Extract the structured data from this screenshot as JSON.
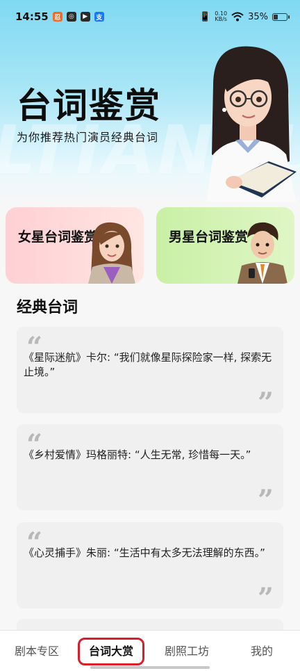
{
  "status_bar": {
    "time": "14:55",
    "app_icons": [
      {
        "name": "app-icon-orange",
        "color": "#f06a2a",
        "glyph": "忍"
      },
      {
        "name": "app-icon-dark-swirl",
        "color": "#2a2a2a",
        "glyph": "◎"
      },
      {
        "name": "app-icon-play",
        "color": "#2b2b2b",
        "glyph": "▶"
      },
      {
        "name": "app-icon-alipay",
        "color": "#1677ff",
        "glyph": "支"
      }
    ],
    "net_speed_value": "0.10",
    "net_speed_unit": "KB/s",
    "battery": "35%",
    "battery_level": 0.35
  },
  "banner": {
    "title": "台词鉴赏",
    "subtitle": "为你推荐热门演员经典台词",
    "watermark": "LTIANXUA"
  },
  "categories": [
    {
      "label": "女星台词鉴赏"
    },
    {
      "label": "男星台词鉴赏"
    }
  ],
  "section": {
    "title": "经典台词"
  },
  "quotes": [
    {
      "text": "《星际迷航》卡尔: “我们就像星际探险家一样, 探索无止境。”"
    },
    {
      "text": "《乡村爱情》玛格丽特: “人生无常, 珍惜每一天。”"
    },
    {
      "text": "《心灵捕手》朱丽: “生活中有太多无法理解的东西。”"
    }
  ],
  "bottom_nav": {
    "items": [
      "剧本专区",
      "台词大赏",
      "剧照工坊",
      "我的"
    ],
    "active_index": 1
  },
  "colors": {
    "highlight": "#d61f2b",
    "female_card": "#ffd0d4",
    "male_card": "#c9f0a6",
    "banner_top": "#7fd9f2"
  }
}
